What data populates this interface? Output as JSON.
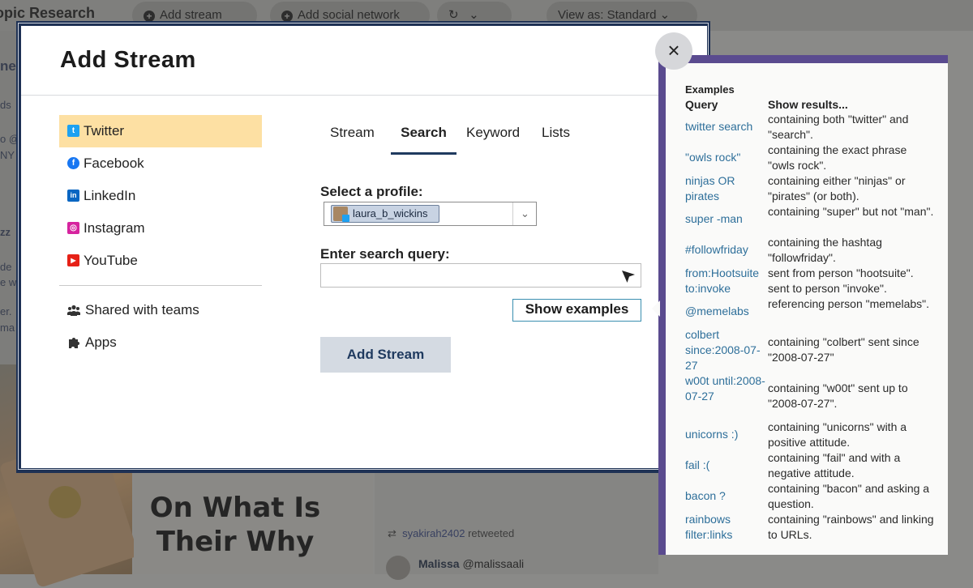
{
  "background": {
    "app_title": "opic Research",
    "buttons": [
      "Add stream",
      "Add social network",
      "View as: Standard"
    ],
    "snippets": [
      "ne",
      "ds",
      "o @",
      "NY",
      "zz",
      "de",
      "e w",
      "er.",
      "ma"
    ],
    "poster_text": "On What Is Their Why",
    "retweet_user": "syakirah2402",
    "retweet_suffix": " retweeted",
    "tweet_name": "Malissa",
    "tweet_handle": "@malissaali"
  },
  "modal": {
    "title": "Add Stream",
    "close_glyph": "×",
    "networks": [
      {
        "label": "Twitter",
        "icon": "twitter-icon",
        "color": "#1da1f2",
        "glyph": "t"
      },
      {
        "label": "Facebook",
        "icon": "facebook-icon",
        "color": "#1877f2",
        "glyph": "f"
      },
      {
        "label": "LinkedIn",
        "icon": "linkedin-icon",
        "color": "#0a66c2",
        "glyph": "in"
      },
      {
        "label": "Instagram",
        "icon": "instagram-icon",
        "color": "#d6249f",
        "glyph": "◎"
      },
      {
        "label": "YouTube",
        "icon": "youtube-icon",
        "color": "#e62117",
        "glyph": "▶"
      }
    ],
    "secondary": [
      {
        "label": "Shared with teams",
        "icon": "teams-icon"
      },
      {
        "label": "Apps",
        "icon": "puzzle-icon"
      }
    ],
    "tabs": [
      "Stream",
      "Search",
      "Keyword",
      "Lists"
    ],
    "active_tab": "Search",
    "profile_label": "Select a profile:",
    "profile_value": "laura_b_wickins",
    "query_label": "Enter search query:",
    "query_value": "",
    "show_examples": "Show examples",
    "add_stream": "Add Stream"
  },
  "examples": {
    "heading": "Examples",
    "col_query": "Query",
    "col_results": "Show results...",
    "rows": [
      {
        "query": "twitter search",
        "result": "containing both \"twitter\" and \"search\"."
      },
      {
        "query": "\"owls rock\"",
        "result": "containing the exact phrase \"owls rock\"."
      },
      {
        "query": "ninjas OR pirates",
        "result": "containing either \"ninjas\" or \"pirates\" (or both)."
      },
      {
        "query": "super -man",
        "result": "containing \"super\" but not \"man\"."
      },
      {
        "query": "#followfriday",
        "result": "containing the hashtag \"followfriday\"."
      },
      {
        "query": "from:Hootsuite",
        "result": "sent from person \"hootsuite\"."
      },
      {
        "query": "to:invoke",
        "result": "sent to person \"invoke\"."
      },
      {
        "query": "@memelabs",
        "result": "referencing person \"memelabs\"."
      },
      {
        "query": "colbert since:2008-07-27",
        "result": "containing \"colbert\" sent since \"2008-07-27\""
      },
      {
        "query": "w00t until:2008-07-27",
        "result": "containing \"w00t\" sent up to \"2008-07-27\"."
      },
      {
        "query": "unicorns :)",
        "result": "containing \"unicorns\" with a positive attitude."
      },
      {
        "query": "fail :(",
        "result": "containing \"fail\" and with a negative attitude."
      },
      {
        "query": "bacon ?",
        "result": "containing \"bacon\" and asking a question."
      },
      {
        "query": "rainbows filter:links",
        "result": "containing \"rainbows\" and linking to URLs."
      }
    ]
  }
}
